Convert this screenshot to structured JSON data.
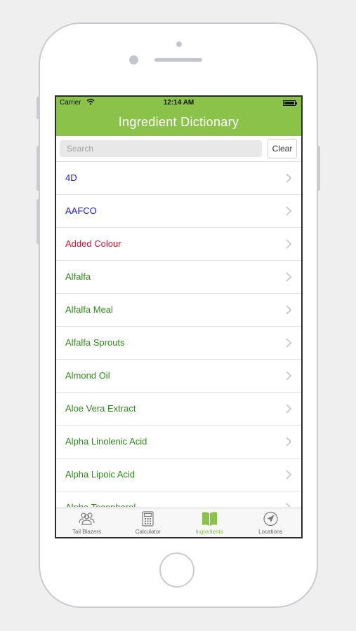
{
  "status_bar": {
    "carrier": "Carrier",
    "time": "12:14 AM",
    "battery_level": 1.0
  },
  "header": {
    "title": "Ingredient Dictionary",
    "color": "#8bc34a"
  },
  "search": {
    "placeholder": "Search",
    "value": "",
    "clear_label": "Clear"
  },
  "list": {
    "items": [
      {
        "label": "4D",
        "color": "#1a1adb"
      },
      {
        "label": "AAFCO",
        "color": "#1a1adb"
      },
      {
        "label": "Added Colour",
        "color": "#e0102b"
      },
      {
        "label": "Alfalfa",
        "color": "#2c8a17"
      },
      {
        "label": "Alfalfa Meal",
        "color": "#2c8a17"
      },
      {
        "label": "Alfalfa Sprouts",
        "color": "#2c8a17"
      },
      {
        "label": "Almond Oil",
        "color": "#2c8a17"
      },
      {
        "label": "Aloe Vera Extract",
        "color": "#2c8a17"
      },
      {
        "label": "Alpha Linolenic Acid",
        "color": "#2c8a17"
      },
      {
        "label": "Alpha Lipoic Acid",
        "color": "#2c8a17"
      },
      {
        "label": "Alpha Tocopherol",
        "color": "#2c8a17"
      }
    ]
  },
  "tabbar": {
    "active_color": "#8bc34a",
    "tabs": [
      {
        "label": "Tail Blazers",
        "icon": "group-icon",
        "active": false
      },
      {
        "label": "Calculator",
        "icon": "calculator-icon",
        "active": false
      },
      {
        "label": "Ingredients",
        "icon": "book-icon",
        "active": true
      },
      {
        "label": "Locations",
        "icon": "location-arrow-icon",
        "active": false
      }
    ]
  }
}
